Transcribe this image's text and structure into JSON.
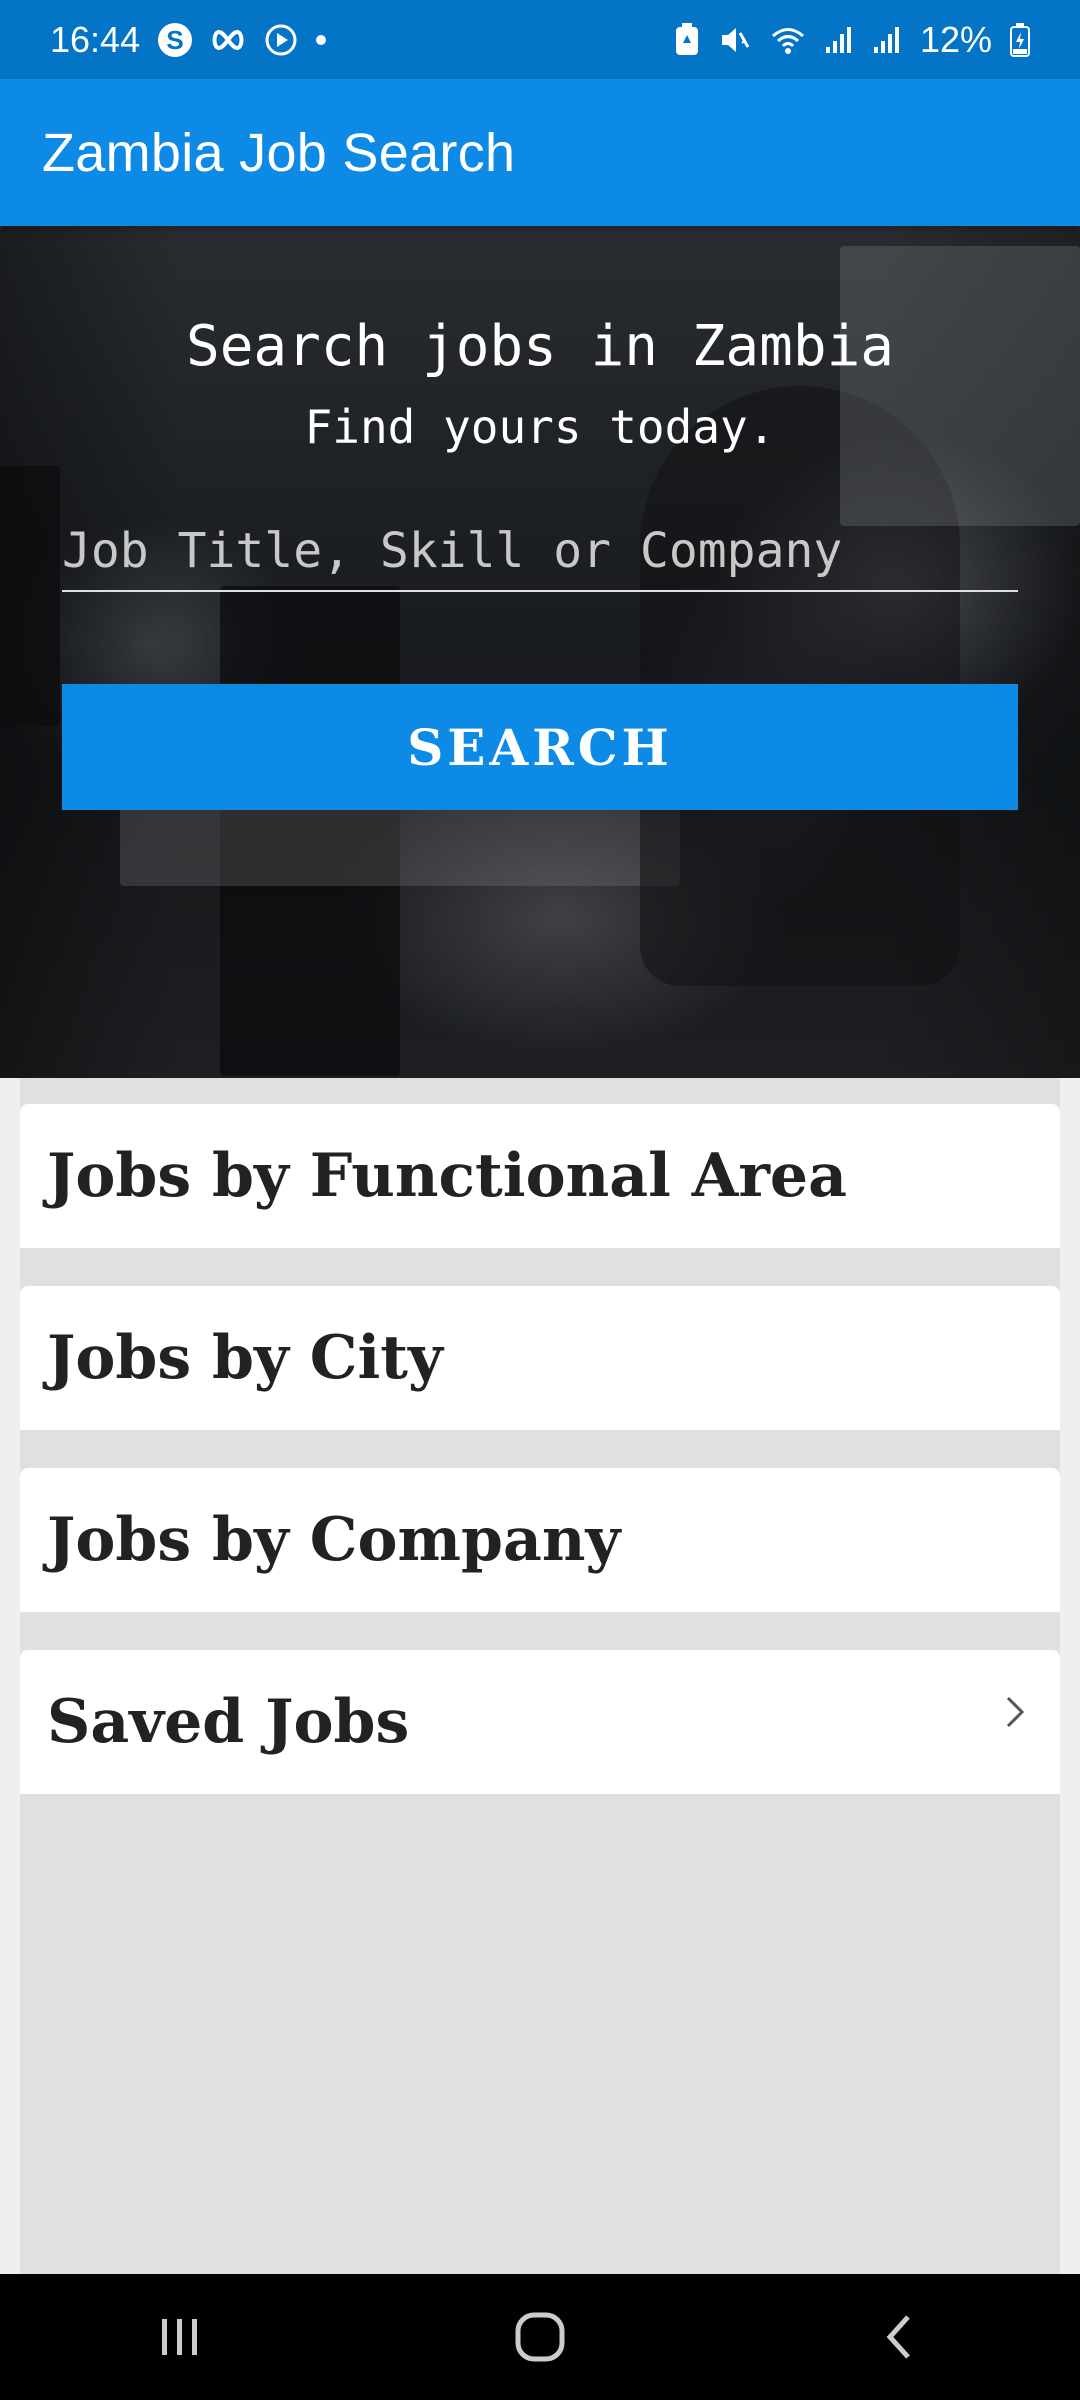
{
  "status_bar": {
    "time": "16:44",
    "battery": "12%",
    "left_icons": [
      "skype-icon",
      "infinity-icon",
      "play-icon",
      "dot-icon"
    ],
    "right_icons": [
      "battery-saver-icon",
      "mute-icon",
      "wifi-icon",
      "signal-icon",
      "signal-icon",
      "battery-icon"
    ]
  },
  "app_bar": {
    "title": "Zambia Job Search",
    "color": "#0d8ae5"
  },
  "hero": {
    "title": "Search jobs in Zambia",
    "subtitle": "Find yours today.",
    "search_placeholder": "Job Title, Skill or Company",
    "search_value": "",
    "search_button": "SEARCH",
    "button_color": "#0d8ae5"
  },
  "menu": {
    "items": [
      {
        "label": "Jobs by Functional Area"
      },
      {
        "label": "Jobs by City"
      },
      {
        "label": "Jobs by Company"
      },
      {
        "label": "Saved Jobs",
        "icon": "chevron-right-icon"
      }
    ]
  },
  "nav_bar": {
    "buttons": [
      "recents-icon",
      "home-icon",
      "back-icon"
    ]
  }
}
